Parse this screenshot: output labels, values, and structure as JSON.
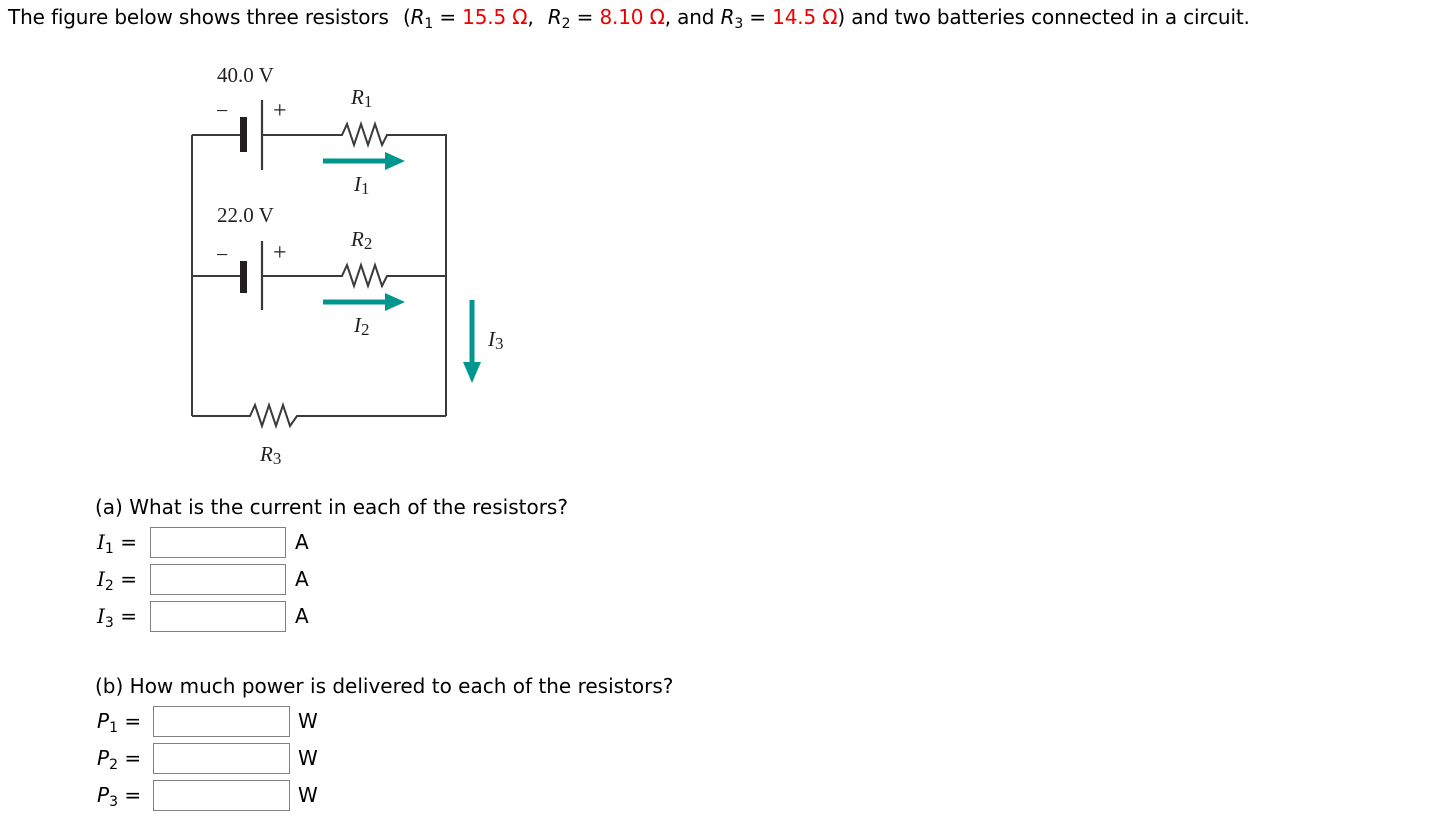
{
  "problem": {
    "intro": "The figure below shows three resistors",
    "open_paren": "(",
    "r1_symbol": "R",
    "r1_sub": "1",
    "r1_value": "15.5 Ω",
    "r2_symbol": "R",
    "r2_sub": "2",
    "r2_value": "8.10 Ω",
    "r3_symbol": "R",
    "r3_sub": "3",
    "r3_value": "14.5 Ω",
    "equals": "=",
    "comma": ",",
    "and": "and",
    "close_paren": ")",
    "outro": "and two batteries connected in a circuit.",
    "value_color": "#ee0000"
  },
  "figure": {
    "battery1_voltage": "40.0 V",
    "battery2_voltage": "22.0 V",
    "minus_sign": "−",
    "plus_sign": "+",
    "r1_label": "R",
    "r1_sub": "1",
    "r2_label": "R",
    "r2_sub": "2",
    "r3_label": "R",
    "r3_sub": "3",
    "i1_label": "I",
    "i1_sub": "1",
    "i2_label": "I",
    "i2_sub": "2",
    "i3_label": "I",
    "i3_sub": "3",
    "wire_color": "#3a3a3a",
    "arrow_color": "#00958f"
  },
  "part_a": {
    "question": "(a) What is the current in each of the resistors?",
    "rows": [
      {
        "symbol": "I",
        "sub": "1",
        "equals": "=",
        "value": "",
        "unit": "A"
      },
      {
        "symbol": "I",
        "sub": "2",
        "equals": "=",
        "value": "",
        "unit": "A"
      },
      {
        "symbol": "I",
        "sub": "3",
        "equals": "=",
        "value": "",
        "unit": "A"
      }
    ]
  },
  "part_b": {
    "question": "(b) How much power is delivered to each of the resistors?",
    "rows": [
      {
        "symbol": "P",
        "sub": "1",
        "equals": "=",
        "value": "",
        "unit": "W"
      },
      {
        "symbol": "P",
        "sub": "2",
        "equals": "=",
        "value": "",
        "unit": "W"
      },
      {
        "symbol": "P",
        "sub": "3",
        "equals": "=",
        "value": "",
        "unit": "W"
      }
    ]
  }
}
